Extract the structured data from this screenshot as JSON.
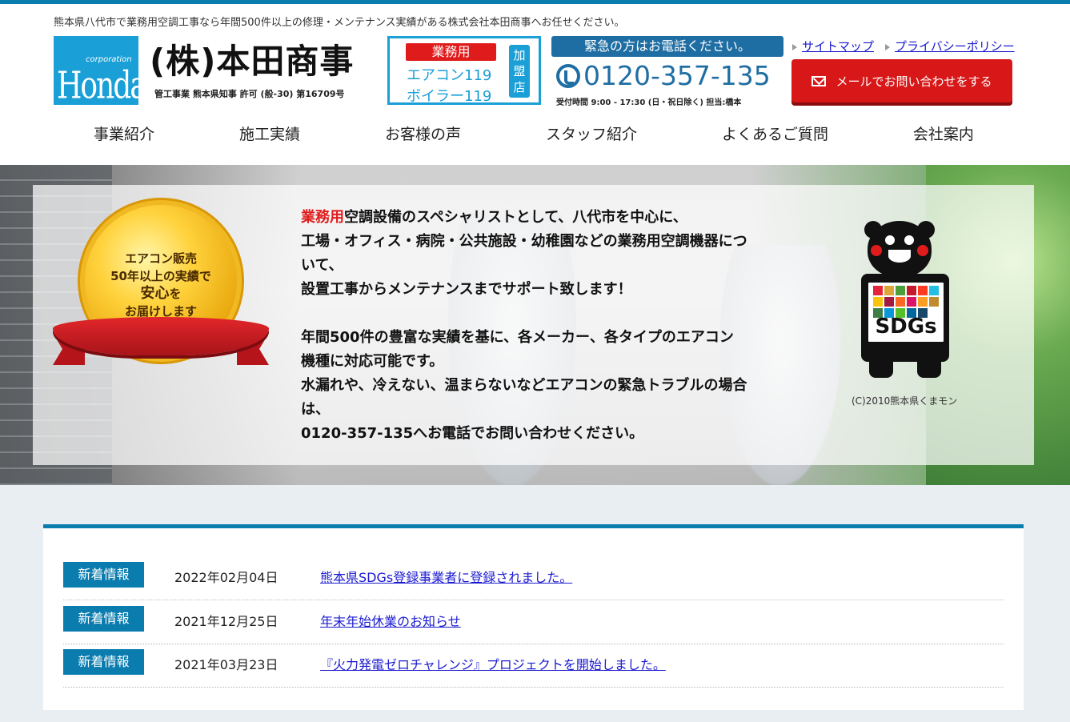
{
  "header": {
    "tagline": "熊本県八代市で業務用空調工事なら年間500件以上の修理・メンテナンス実績がある株式会社本田商事へお任せください。",
    "logo": {
      "corporation": "corporation",
      "brand": "Honda"
    },
    "company_name": "(株)本田商事",
    "license": "管工事業 熊本県知事 許可 (般-30) 第16709号",
    "member": {
      "badge": "業務用",
      "line1": "エアコン119",
      "line2": "ボイラー119",
      "member_label": "加盟店"
    },
    "phone": {
      "banner": "緊急の方はお電話ください。",
      "number": "0120-357-135",
      "hours": "受付時間 9:00 - 17:30 (日・祝日除く) 担当:橋本"
    },
    "links": {
      "sitemap": "サイトマップ",
      "privacy": "プライバシーポリシー"
    },
    "mail_button": "メールでお問い合わせをする"
  },
  "nav": [
    "事業紹介",
    "施工実績",
    "お客様の声",
    "スタッフ紹介",
    "よくあるご質問",
    "会社案内"
  ],
  "hero": {
    "medal": {
      "line1": "エアコン販売",
      "line2": "50年以上の実績で",
      "line3a": "安心",
      "line3b": "を",
      "line4": "お届けします"
    },
    "text": {
      "p1_highlight": "業務用",
      "p1_rest": "空調設備のスペシャリストとして、八代市を中心に、",
      "p1_line2": "工場・オフィス・病院・公共施設・幼稚園などの業務用空調機器につ",
      "p1_line3": "いて、",
      "p1_line4": "設置工事からメンテナンスまでサポート致します！",
      "p2_line1": "年間500件の豊富な実績を基に、各メーカー、各タイプのエアコン",
      "p2_line2": "機種に対応可能です。",
      "p2_line3": "水漏れや、冷えない、温まらないなどエアコンの緊急トラブルの場合",
      "p2_line4": "は、",
      "p2_line5": "0120-357-135へお電話でお問い合わせください。"
    },
    "kumamon": {
      "sign": "SDGs",
      "copyright": "(C)2010熊本県くまモン"
    },
    "sdg_colors": [
      "#e5243b",
      "#dda63a",
      "#4c9f38",
      "#c5192d",
      "#ff3a21",
      "#26bde2",
      "#fcc30b",
      "#a21942",
      "#fd6925",
      "#dd1367",
      "#fd9d24",
      "#bf8b2e",
      "#3f7e44",
      "#0a97d9",
      "#56c02b",
      "#00689d",
      "#19486a"
    ]
  },
  "news": [
    {
      "tag": "新着情報",
      "date": "2022年02月04日",
      "title": "熊本県SDGs登録事業者に登録されました。"
    },
    {
      "tag": "新着情報",
      "date": "2021年12月25日",
      "title": "年末年始休業のお知らせ"
    },
    {
      "tag": "新着情報",
      "date": "2021年03月23日",
      "title": "『火力発電ゼロチャレンジ』プロジェクトを開始しました。"
    }
  ]
}
